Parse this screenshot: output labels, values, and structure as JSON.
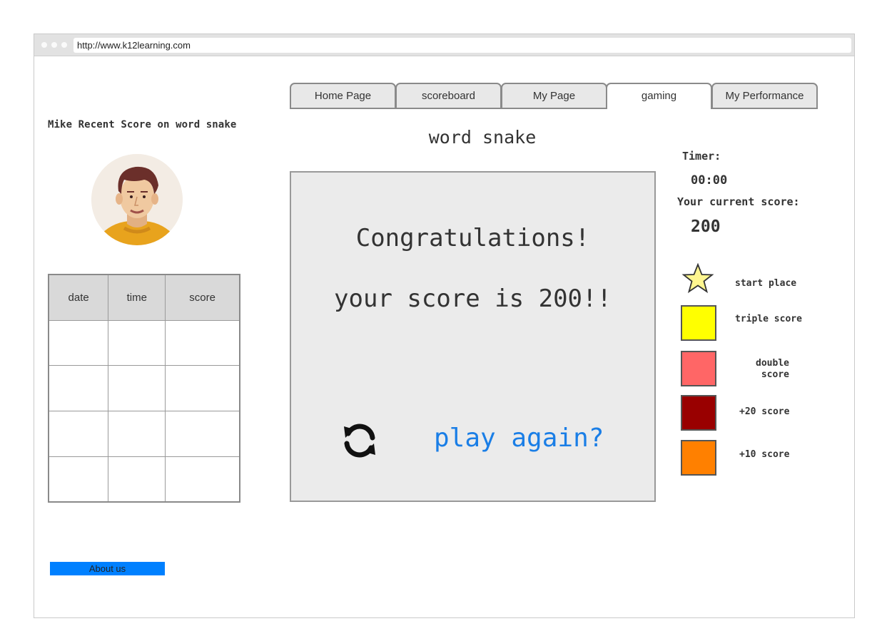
{
  "browser": {
    "url": "http://www.k12learning.com"
  },
  "tabs": [
    {
      "label": "Home Page",
      "active": false
    },
    {
      "label": "scoreboard",
      "active": false
    },
    {
      "label": "My Page",
      "active": false
    },
    {
      "label": "gaming",
      "active": true
    },
    {
      "label": "My Performance",
      "active": false
    }
  ],
  "sidebar": {
    "title": "Mike Recent Score on word snake",
    "avatar_icon": "user-avatar",
    "table": {
      "headers": [
        "date",
        "time",
        "score"
      ],
      "rows": [
        [
          "",
          "",
          ""
        ],
        [
          "",
          "",
          ""
        ],
        [
          "",
          "",
          ""
        ],
        [
          "",
          "",
          ""
        ]
      ]
    },
    "about_label": "About us"
  },
  "game": {
    "title": "word snake",
    "congrats": "Congratulations!",
    "score_line": "your score is  200!!",
    "refresh_icon": "refresh-icon",
    "play_again": "play again?"
  },
  "status": {
    "timer_label": "Timer:",
    "timer_value": "00:00",
    "score_label": "Your current score:",
    "score_value": "200"
  },
  "legend": [
    {
      "label": "start place",
      "icon": "star-icon",
      "color": "#fff68f"
    },
    {
      "label": "triple score",
      "color": "#ffff00"
    },
    {
      "label": "double score",
      "color": "#ff6666"
    },
    {
      "label": "+20 score",
      "color": "#990000"
    },
    {
      "label": "+10 score",
      "color": "#ff8000"
    }
  ],
  "colors": {
    "accent": "#0080ff",
    "link": "#1a7ee6"
  }
}
